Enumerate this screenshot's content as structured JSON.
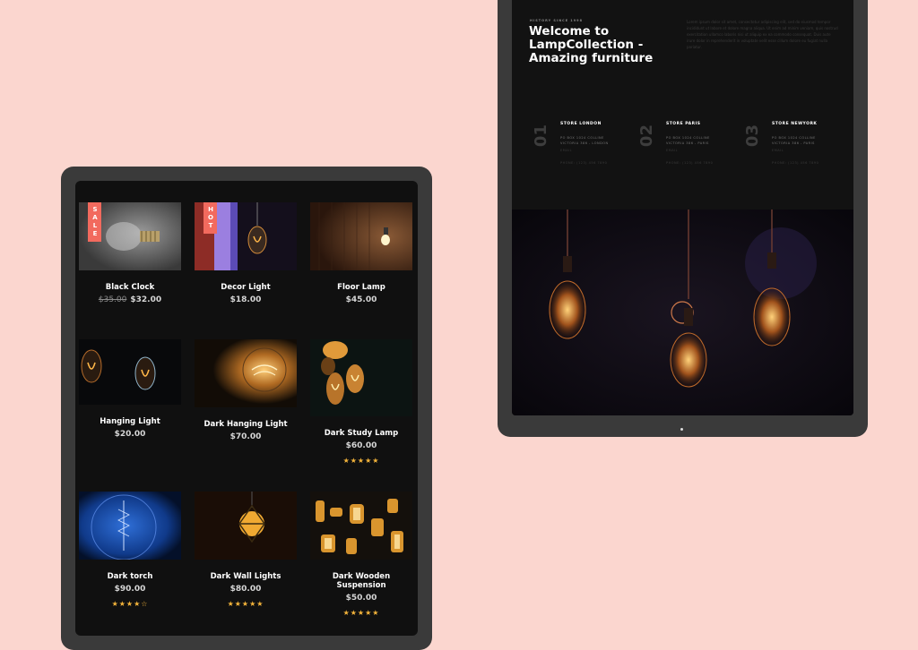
{
  "shop": {
    "products": [
      {
        "name": "Black Clock",
        "old_price": "$35.00",
        "price": "$32.00",
        "badge": "SALE",
        "stars": ""
      },
      {
        "name": "Decor Light",
        "old_price": "",
        "price": "$18.00",
        "badge": "HOT",
        "stars": ""
      },
      {
        "name": "Floor Lamp",
        "old_price": "",
        "price": "$45.00",
        "badge": "",
        "stars": ""
      },
      {
        "name": "Hanging Light",
        "old_price": "",
        "price": "$20.00",
        "badge": "",
        "stars": ""
      },
      {
        "name": "Dark Hanging Light",
        "old_price": "",
        "price": "$70.00",
        "badge": "",
        "stars": ""
      },
      {
        "name": "Dark Study Lamp",
        "old_price": "",
        "price": "$60.00",
        "badge": "",
        "stars": "★★★★★"
      },
      {
        "name": "Dark torch",
        "old_price": "",
        "price": "$90.00",
        "badge": "",
        "stars": "★★★★☆"
      },
      {
        "name": "Dark Wall Lights",
        "old_price": "",
        "price": "$80.00",
        "badge": "",
        "stars": "★★★★★"
      },
      {
        "name": "Dark Wooden Suspension",
        "old_price": "",
        "price": "$50.00",
        "badge": "",
        "stars": "★★★★★"
      }
    ]
  },
  "about": {
    "eyebrow": "HISTORY SINCE 1998",
    "title": "Welcome to LampCollection - Amazing furniture",
    "intro": "Lorem ipsum dolor sit amet, consectetur adipiscing elit, sed do eiusmod tempor incididunt ut labore et dolore magna aliqua. Ut enim ad minim veniam, quis nostrud exercitation ullamco laboris nisi ut aliquip ex ea commodo consequat. Duis aute irure dolor in reprehenderit in voluptate velit esse cillum dolore eu fugiat nulla pariatur.",
    "stores": [
      {
        "num": "01",
        "title": "STORE LONDON",
        "line1": "PO BOX 1024 COLLINE",
        "line2": "VICTORIA 386 - LONDON",
        "line3": "EMAIL",
        "line4": "PHONE: (123) 456 7890"
      },
      {
        "num": "02",
        "title": "STORE PARIS",
        "line1": "PO BOX 1024 COLLINE",
        "line2": "VICTORIA 386 - PARIS",
        "line3": "EMAIL",
        "line4": "PHONE: (123) 456 7890"
      },
      {
        "num": "03",
        "title": "STORE NEWYORK",
        "line1": "PO BOX 1024 COLLINE",
        "line2": "VICTORIA 386 - PARIS",
        "line3": "EMAIL",
        "line4": "PHONE: (123) 456 7890"
      }
    ]
  }
}
